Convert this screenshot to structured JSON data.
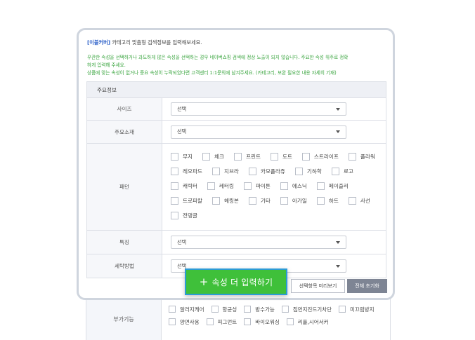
{
  "intro": {
    "brand": "[이블커버]",
    "text": " 카테고리 맞춤형 검색정보를 입력해보세요."
  },
  "warning": {
    "line1": "우관한 속성을 선택하거나 과도하게 많은 속성을 선택하는 경우 네이버쇼핑 검색에 정상 노출이 되지 않습니다. 주요한 속성 위주로 정확",
    "line2": "하게 입력해 주세요.",
    "line3": "상품에 맞는 속성이 없거나 중요 속성이 누락되었다면 고객센터 1:1문의에 남겨주세요. (카테고리, 보완 필요한 내용 자세히 기재)"
  },
  "table": {
    "header": "주요정보",
    "size": {
      "label": "사이즈",
      "value": "선택"
    },
    "material": {
      "label": "주요소재",
      "value": "선택"
    },
    "pattern": {
      "label": "패턴",
      "rows": [
        [
          "무지",
          "체크",
          "프린트",
          "도트",
          "스트라이프",
          "플라워"
        ],
        [
          "레오파드",
          "지브라",
          "카모플라쥬",
          "기하학",
          "로고"
        ],
        [
          "캐릭터",
          "레터링",
          "파이톤",
          "에스닉",
          "페이즐리"
        ],
        [
          "트로피칼",
          "헤링본",
          "기타",
          "아가일",
          "하트",
          "사선"
        ],
        [
          "전댕글"
        ]
      ]
    },
    "feature": {
      "label": "특징",
      "value": "선택"
    },
    "wash": {
      "label": "세탁방법",
      "value": "선택"
    }
  },
  "buttons": {
    "more_plus": "+",
    "more": "속성 더 입력하기",
    "preview": "선택항목 미리보기",
    "reset": "전체 초기화"
  },
  "background_form": {
    "label": "부가기능",
    "options": [
      "알러지케어",
      "항균성",
      "방수가능",
      "집먼지진드기차단",
      "미끄럼방지",
      "양면사용",
      "피그먼트",
      "바이오워싱",
      "리플,시어서커"
    ]
  }
}
